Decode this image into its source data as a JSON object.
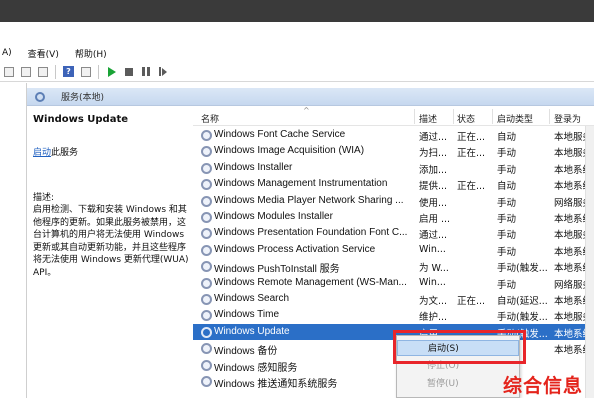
{
  "menu": [
    "A)",
    "查看(V)",
    "帮助(H)"
  ],
  "toolbar_icons": [
    "back-icon",
    "forward-icon",
    "properties-icon",
    "help-icon",
    "console-icon",
    "start-icon",
    "stop-icon",
    "pause-icon",
    "restart-icon"
  ],
  "services_header": "服务(本地)",
  "desc": {
    "title": "Windows Update",
    "start_link": "启动",
    "start_suffix": "此服务",
    "label": "描述:",
    "text": "启用检测、下载和安装 Windows 和其他程序的更新。如果此服务被禁用，这台计算机的用户将无法使用 Windows 更新或其自动更新功能，并且这些程序将无法使用 Windows 更新代理(WUA) API。"
  },
  "columns": [
    "名称",
    "描述",
    "状态",
    "启动类型",
    "登录为"
  ],
  "rows": [
    {
      "name": "Windows Font Cache Service",
      "desc": "通过...",
      "status": "正在...",
      "startup": "自动",
      "logon": "本地服务"
    },
    {
      "name": "Windows Image Acquisition (WIA)",
      "desc": "为扫...",
      "status": "正在...",
      "startup": "手动",
      "logon": "本地服务"
    },
    {
      "name": "Windows Installer",
      "desc": "添加...",
      "status": "",
      "startup": "手动",
      "logon": "本地系统"
    },
    {
      "name": "Windows Management Instrumentation",
      "desc": "提供...",
      "status": "正在...",
      "startup": "自动",
      "logon": "本地系统"
    },
    {
      "name": "Windows Media Player Network Sharing ...",
      "desc": "使用...",
      "status": "",
      "startup": "手动",
      "logon": "网络服务"
    },
    {
      "name": "Windows Modules Installer",
      "desc": "启用 ...",
      "status": "",
      "startup": "手动",
      "logon": "本地系统"
    },
    {
      "name": "Windows Presentation Foundation Font C...",
      "desc": "通过...",
      "status": "",
      "startup": "手动",
      "logon": "本地服务"
    },
    {
      "name": "Windows Process Activation Service",
      "desc": "Win...",
      "status": "",
      "startup": "手动",
      "logon": "本地系统"
    },
    {
      "name": "Windows PushToInstall 服务",
      "desc": "为 W...",
      "status": "",
      "startup": "手动(触发...",
      "logon": "本地系统"
    },
    {
      "name": "Windows Remote Management (WS-Man...",
      "desc": "Win...",
      "status": "",
      "startup": "手动",
      "logon": "网络服务"
    },
    {
      "name": "Windows Search",
      "desc": "为文...",
      "status": "正在...",
      "startup": "自动(延迟...",
      "logon": "本地系统"
    },
    {
      "name": "Windows Time",
      "desc": "维护...",
      "status": "",
      "startup": "手动(触发...",
      "logon": "本地服务"
    },
    {
      "name": "Windows Update",
      "desc": "启用...",
      "status": "",
      "startup": "手动(触发...",
      "logon": "本地系统"
    },
    {
      "name": "Windows 备份",
      "desc": "",
      "status": "",
      "startup": "",
      "logon": "本地系统"
    },
    {
      "name": "Windows 感知服务",
      "desc": "",
      "status": "",
      "startup": "",
      "logon": ""
    },
    {
      "name": "Windows 推送通知系统服务",
      "desc": "",
      "status": "",
      "startup": "",
      "logon": ""
    }
  ],
  "selected_row": 12,
  "context_menu": [
    {
      "label": "启动(S)",
      "state": "highlighted"
    },
    {
      "label": "停止(O)",
      "state": "disabled"
    },
    {
      "label": "暂停(U)",
      "state": "disabled"
    }
  ],
  "watermark": "综合信息",
  "colors": {
    "selection": "#2b6fc7",
    "highlight_box": "#e8252a",
    "watermark": "#e4241c",
    "header_band": "#c6d8ef"
  }
}
